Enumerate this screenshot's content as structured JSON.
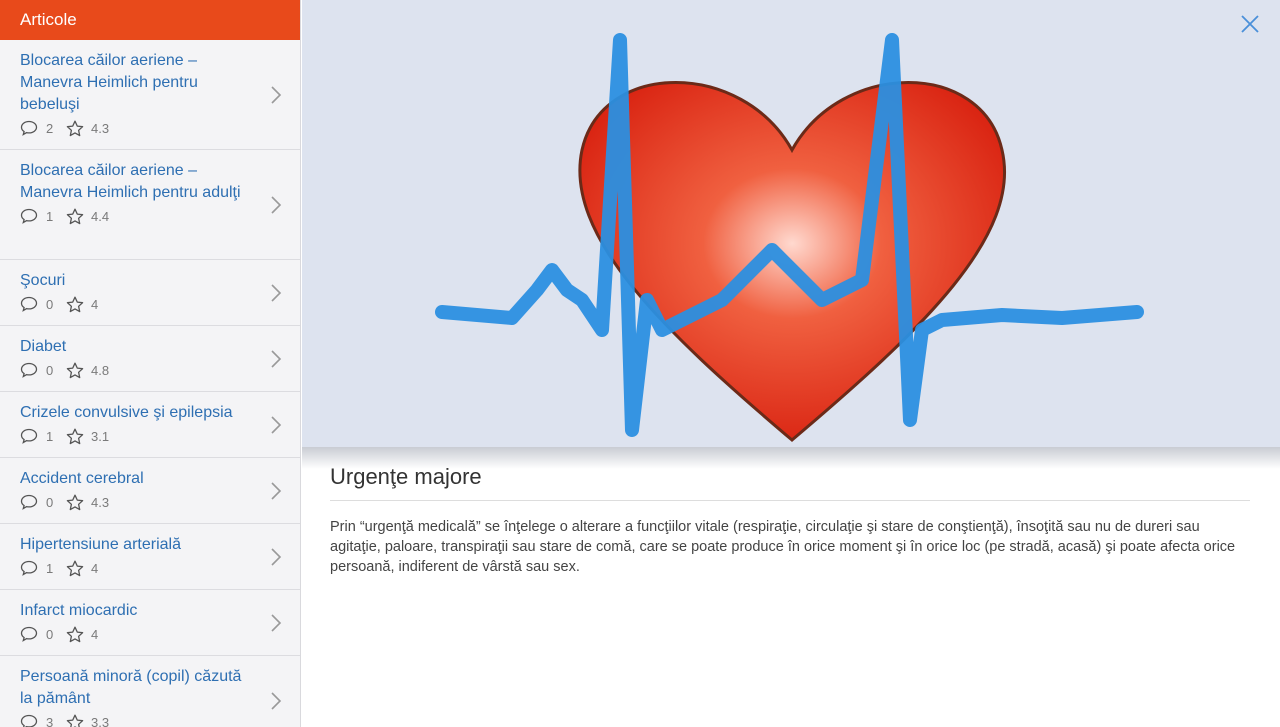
{
  "sidebar": {
    "title": "Articole",
    "items": [
      {
        "title": "Blocarea căilor aeriene – Manevra Heimlich pentru bebeluşi",
        "comments": "2",
        "rating": "4.3"
      },
      {
        "title": "Blocarea căilor aeriene – Manevra Heimlich pentru adulţi",
        "comments": "1",
        "rating": "4.4"
      },
      {
        "title": "Şocuri",
        "comments": "0",
        "rating": "4"
      },
      {
        "title": "Diabet",
        "comments": "0",
        "rating": "4.8"
      },
      {
        "title": "Crizele convulsive şi epilepsia",
        "comments": "1",
        "rating": "3.1"
      },
      {
        "title": "Accident cerebral",
        "comments": "0",
        "rating": "4.3"
      },
      {
        "title": "Hipertensiune arterială",
        "comments": "1",
        "rating": "4"
      },
      {
        "title": "Infarct miocardic",
        "comments": "0",
        "rating": "4"
      },
      {
        "title": "Persoană minoră (copil) căzută la pământ",
        "comments": "3",
        "rating": "3.3"
      }
    ]
  },
  "article": {
    "title": "Urgenţe majore",
    "body": "Prin “urgenţă medicală” se înţelege o alterare a funcţiilor vitale (respiraţie, circulaţie şi stare de conştienţă), însoţită sau nu de dureri sau agitaţie, paloare, transpiraţii sau stare de comă, care se poate produce în orice moment şi în orice loc (pe stradă, acasă) şi poate afecta orice persoană, indiferent de vârstă sau sex."
  },
  "colors": {
    "accent": "#e84a1b",
    "link": "#2e6fb2",
    "heart": "#e8321f",
    "pulse": "#2b8fe0"
  },
  "icons": {
    "close": "close-icon",
    "comment": "comment-icon",
    "star": "star-icon",
    "chevron": "chevron-right-icon"
  }
}
